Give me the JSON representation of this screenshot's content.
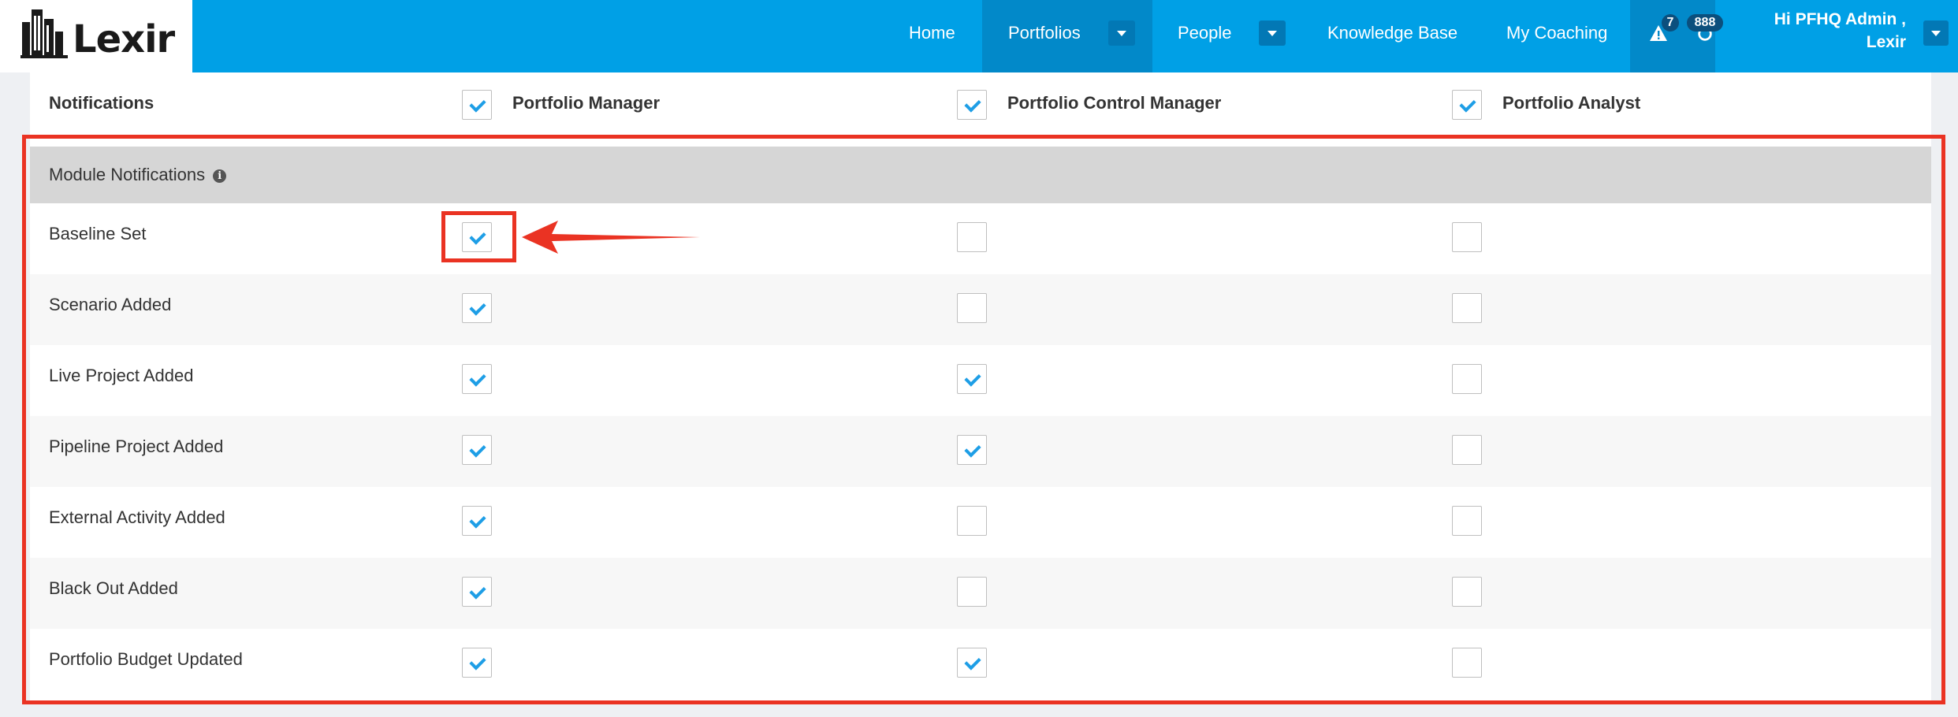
{
  "header": {
    "brand": "Lexir",
    "nav": [
      {
        "label": "Home"
      },
      {
        "label": "Portfolios"
      },
      {
        "label": "People"
      },
      {
        "label": "Knowledge Base"
      },
      {
        "label": "My Coaching"
      }
    ],
    "alerts_count": "7",
    "messages_count": "888",
    "greeting_line1": "Hi PFHQ Admin ,",
    "greeting_line2": "Lexir"
  },
  "table": {
    "columns": [
      {
        "label": "Notifications"
      },
      {
        "label": "Portfolio Manager",
        "checked": true
      },
      {
        "label": "Portfolio Control Manager",
        "checked": true
      },
      {
        "label": "Portfolio Analyst",
        "checked": true
      }
    ],
    "section_title": "Module Notifications",
    "rows": [
      {
        "label": "Baseline Set",
        "values": [
          true,
          false,
          false
        ]
      },
      {
        "label": "Scenario Added",
        "values": [
          true,
          false,
          false
        ]
      },
      {
        "label": "Live Project Added",
        "values": [
          true,
          true,
          false
        ]
      },
      {
        "label": "Pipeline Project Added",
        "values": [
          true,
          true,
          false
        ]
      },
      {
        "label": "External Activity Added",
        "values": [
          true,
          false,
          false
        ]
      },
      {
        "label": "Black Out Added",
        "values": [
          true,
          false,
          false
        ]
      },
      {
        "label": "Portfolio Budget Updated",
        "values": [
          true,
          true,
          false
        ]
      }
    ]
  },
  "colors": {
    "nav_bg": "#00a0e6",
    "nav_active": "#0289c9",
    "check": "#1e9ee6",
    "annotation": "#ea3323",
    "section_bg": "#d6d6d6"
  }
}
